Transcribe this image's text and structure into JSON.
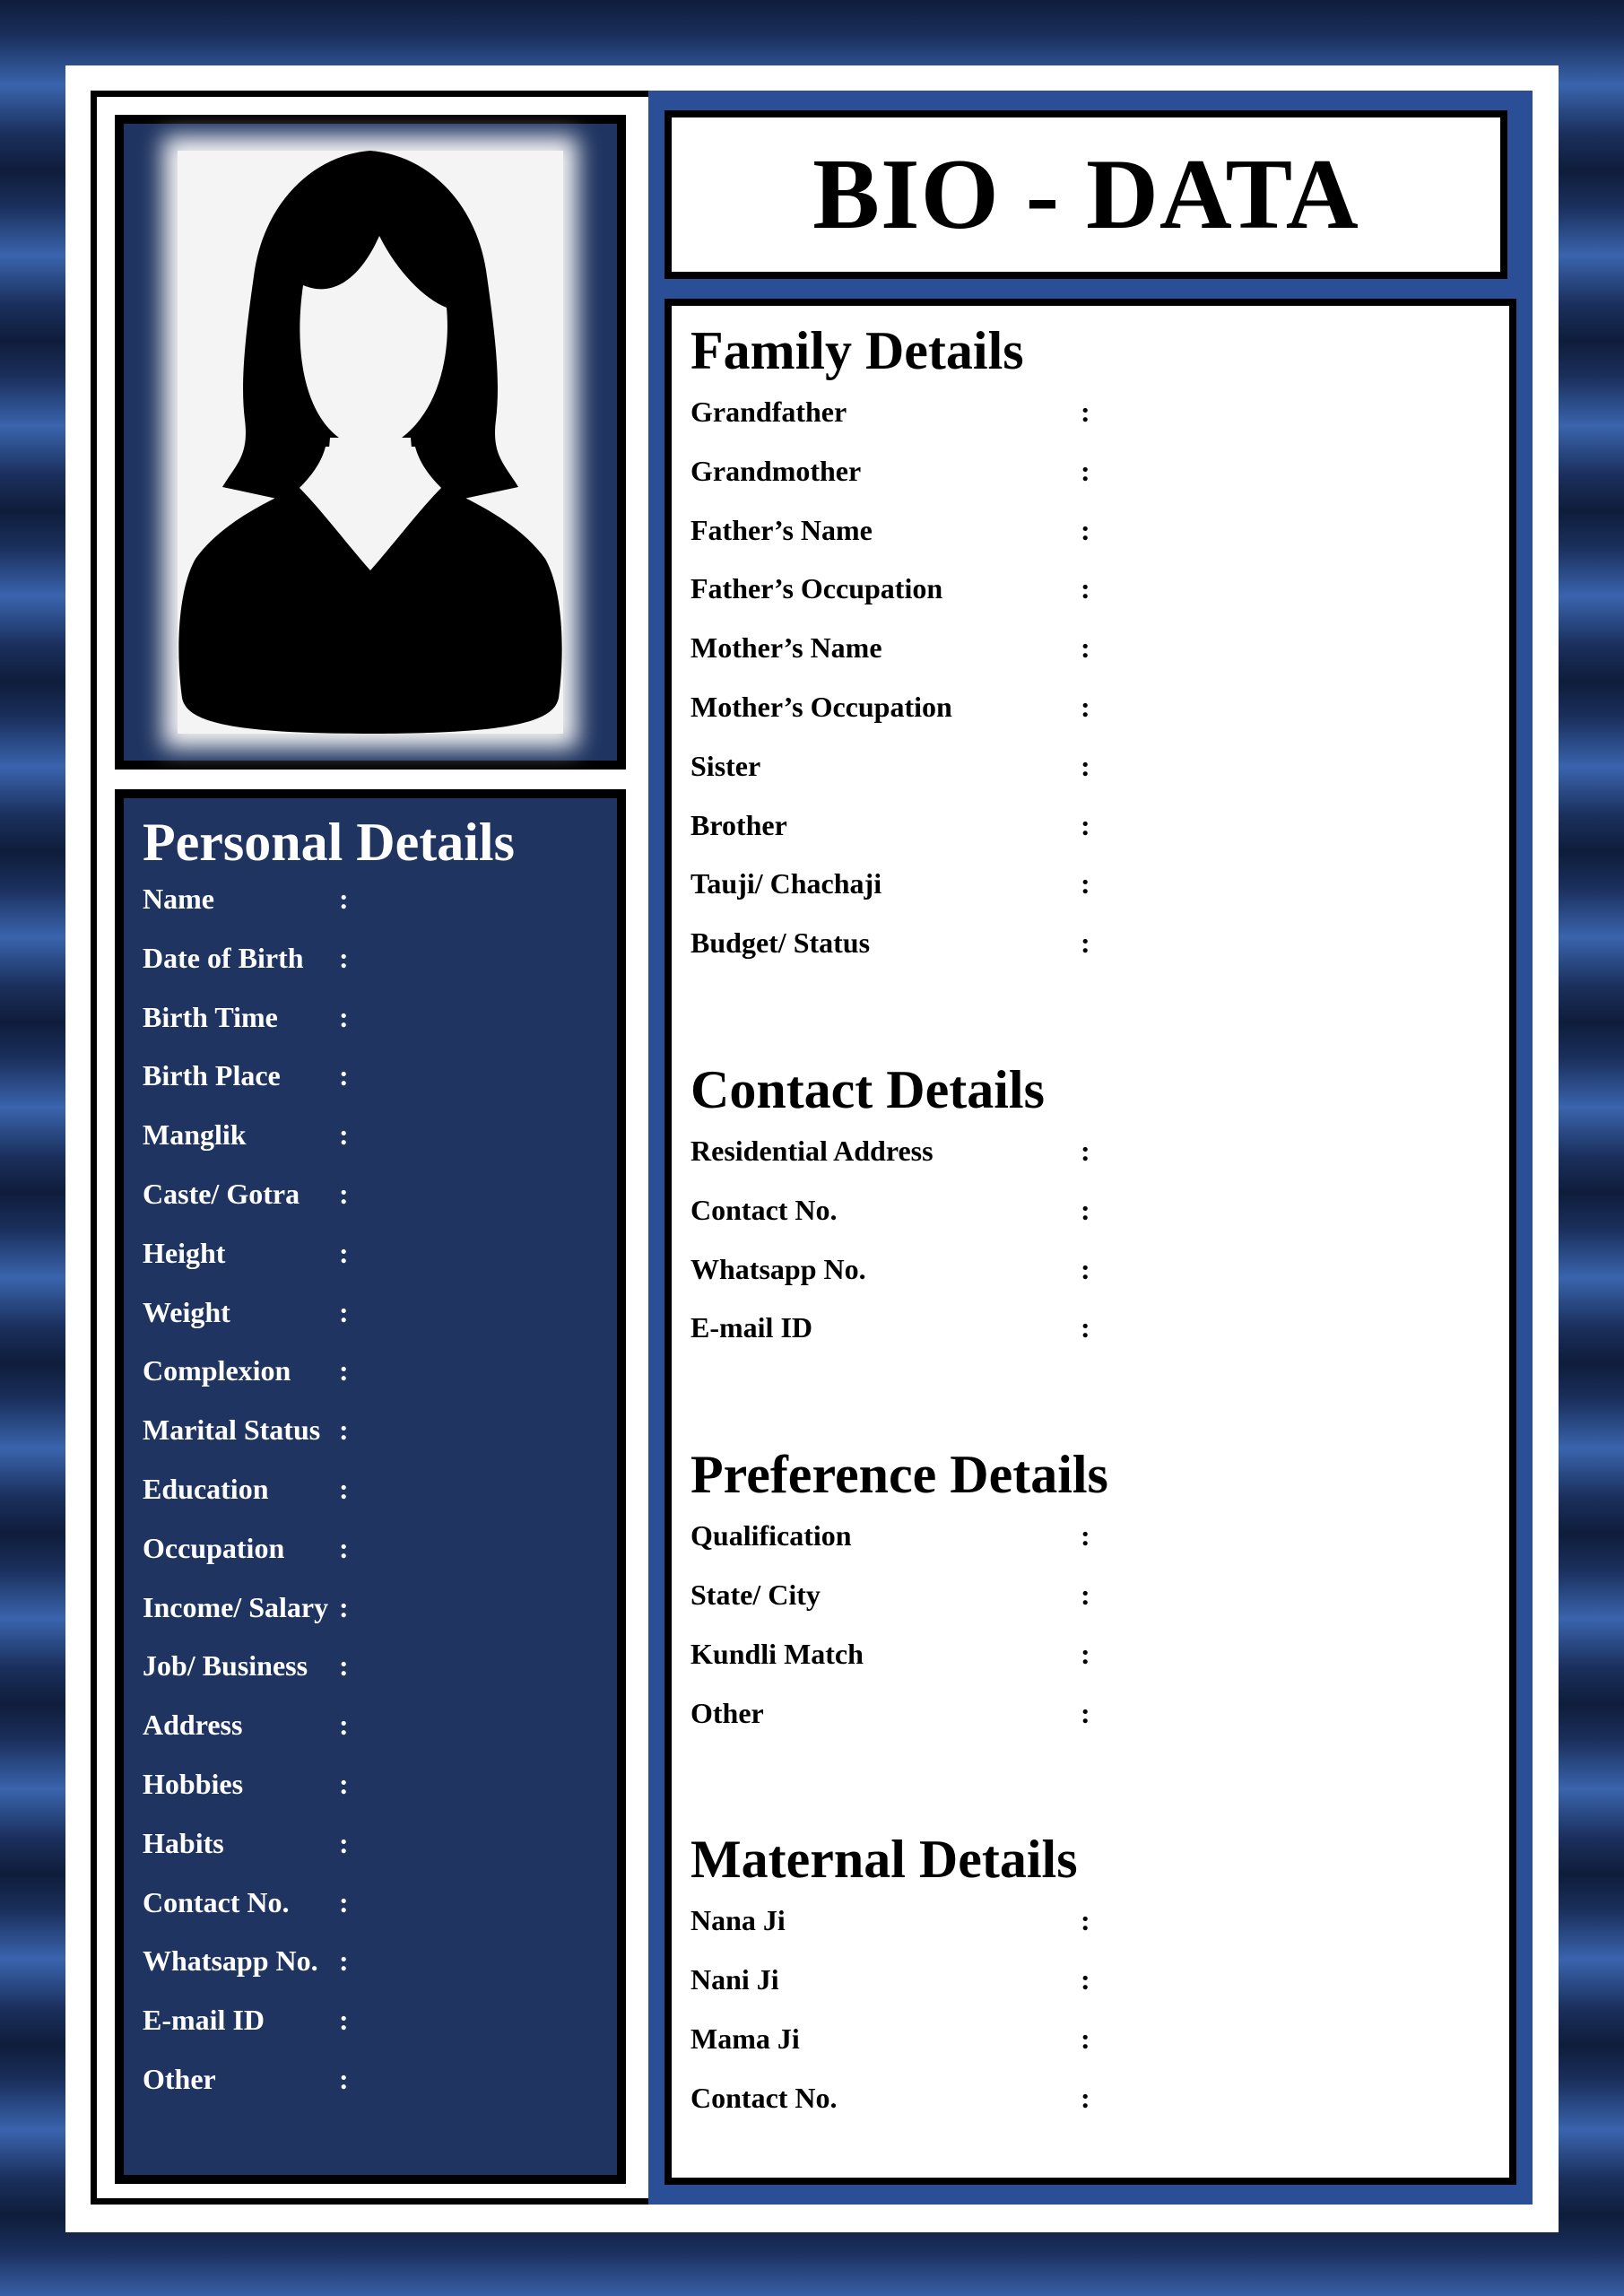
{
  "title": "BIO - DATA",
  "personal": {
    "heading": "Personal Details",
    "fields": [
      "Name",
      "Date of Birth",
      "Birth Time",
      "Birth Place",
      "Manglik",
      "Caste/ Gotra",
      "Height",
      "Weight",
      "Complexion",
      "Marital Status",
      "Education",
      "Occupation",
      "Income/ Salary",
      "Job/ Business",
      "Address",
      "Hobbies",
      "Habits",
      "Contact No.",
      "Whatsapp No.",
      "E-mail ID",
      "Other"
    ]
  },
  "family": {
    "heading": "Family Details",
    "fields": [
      "Grandfather",
      "Grandmother",
      "Father’s Name",
      "Father’s Occupation",
      "Mother’s Name",
      "Mother’s Occupation",
      "Sister",
      "Brother",
      "Tauji/ Chachaji",
      "Budget/ Status"
    ]
  },
  "contact": {
    "heading": "Contact Details",
    "fields": [
      "Residential Address",
      "Contact No.",
      "Whatsapp No.",
      "E-mail ID"
    ]
  },
  "preference": {
    "heading": "Preference Details",
    "fields": [
      "Qualification",
      "State/ City",
      "Kundli Match",
      "Other"
    ]
  },
  "maternal": {
    "heading": "Maternal Details",
    "fields": [
      "Nana Ji",
      "Nani Ji",
      "Mama Ji",
      "Contact No."
    ]
  },
  "separator": ":",
  "icons": {
    "photo": "female-avatar-silhouette-icon"
  },
  "colors": {
    "panel_dark": "#1f3461",
    "panel_blue": "#2a4f96",
    "text_light": "#ffffff",
    "text_dark": "#000000"
  }
}
